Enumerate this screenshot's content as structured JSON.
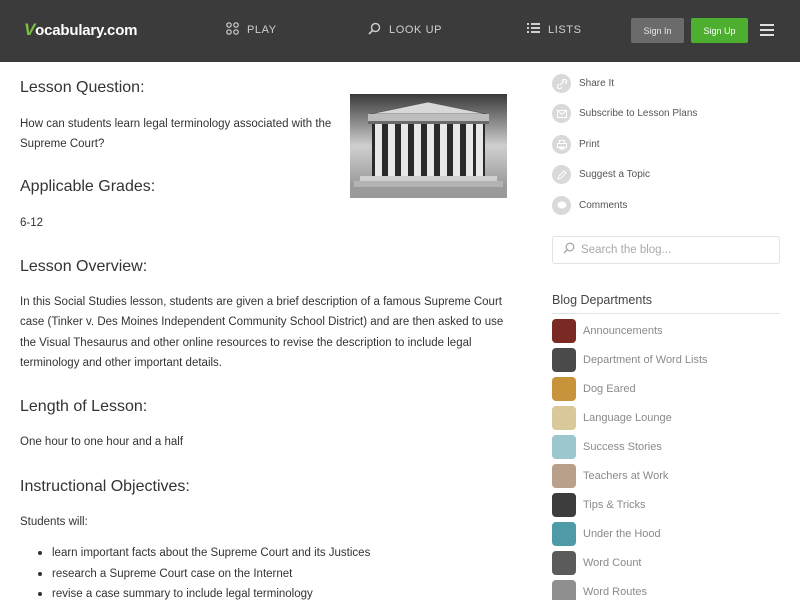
{
  "header": {
    "logo_prefix": "V",
    "logo_rest": "ocabulary.com",
    "nav": [
      {
        "label": "PLAY",
        "icon": "grid-icon"
      },
      {
        "label": "LOOK UP",
        "icon": "search-icon"
      },
      {
        "label": "LISTS",
        "icon": "list-icon"
      }
    ],
    "sign_in": "Sign In",
    "sign_up": "Sign Up"
  },
  "lesson": {
    "question_heading": "Lesson Question:",
    "question_line1": "How can students learn legal terminology associated with the",
    "question_line2": "Supreme Court?",
    "grades_heading": "Applicable Grades:",
    "grades": "6-12",
    "overview_heading": "Lesson Overview:",
    "overview_lines": [
      "In this Social Studies lesson, students are given a brief description of a famous Supreme Court",
      "case (Tinker v. Des Moines Independent Community School District) and are then asked to use",
      "the Visual Thesaurus and other online resources to revise the description to include legal",
      "terminology and other important details."
    ],
    "length_heading": "Length of Lesson:",
    "length": "One hour to one hour and a half",
    "objectives_heading": "Instructional Objectives:",
    "students_will": "Students will:",
    "objectives": [
      "learn important facts about the Supreme Court and its Justices",
      "research a Supreme Court case on the Internet",
      "revise a case summary to include legal terminology"
    ]
  },
  "sidebar": {
    "share": [
      {
        "label": "Share It",
        "icon": "link-icon"
      },
      {
        "label": "Subscribe to Lesson Plans",
        "icon": "mail-icon"
      },
      {
        "label": "Print",
        "icon": "print-icon"
      },
      {
        "label": "Suggest a Topic",
        "icon": "edit-icon"
      },
      {
        "label": "Comments",
        "icon": "comment-icon"
      }
    ],
    "search_placeholder": "Search the blog...",
    "departments_title": "Blog Departments",
    "departments": [
      {
        "label": "Announcements",
        "color": "#7a2a22"
      },
      {
        "label": "Department of Word Lists",
        "color": "#4a4a4a"
      },
      {
        "label": "Dog Eared",
        "color": "#c7943c"
      },
      {
        "label": "Language Lounge",
        "color": "#d8c89a"
      },
      {
        "label": "Success Stories",
        "color": "#9cc7cf"
      },
      {
        "label": "Teachers at Work",
        "color": "#b9a08a"
      },
      {
        "label": "Tips & Tricks",
        "color": "#3d3d3d"
      },
      {
        "label": "Under the Hood",
        "color": "#4e9aa6"
      },
      {
        "label": "Word Count",
        "color": "#5b5b5b"
      },
      {
        "label": "Word Routes",
        "color": "#8f8f8f"
      }
    ]
  },
  "colors": {
    "header_bg": "#3b3b3b",
    "logo_accent": "#7cc242",
    "signup_green": "#4caf2f"
  }
}
